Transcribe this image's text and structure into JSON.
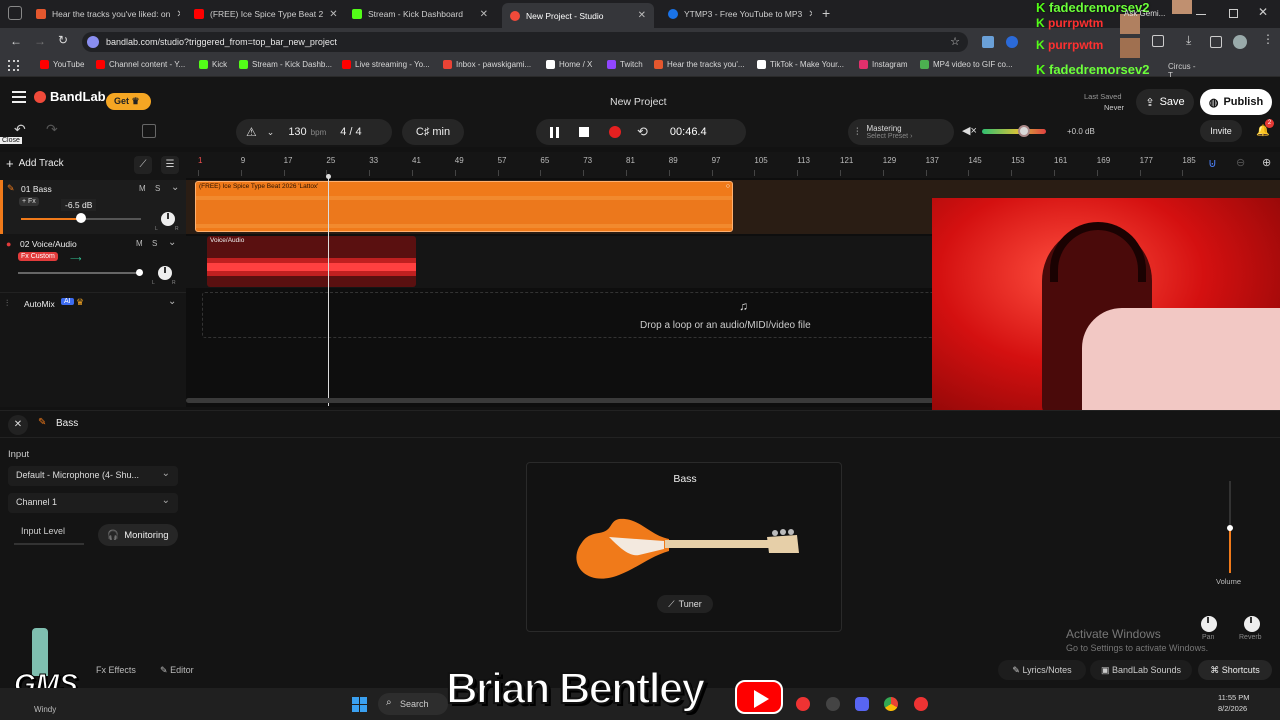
{
  "browser": {
    "tabs": [
      {
        "label": "Hear the tracks you've liked: on",
        "color": "#e4572e"
      },
      {
        "label": "(FREE) Ice Spice Type Beat 2",
        "color": "#ff0000"
      },
      {
        "label": "Stream - Kick Dashboard",
        "color": "#53fc18"
      },
      {
        "label": "New Project - Studio",
        "color": "#f04a3a"
      },
      {
        "label": "YTMP3 - Free YouTube to MP3",
        "color": "#1a73e8"
      }
    ],
    "url": "bandlab.com/studio?triggered_from=top_bar_new_project",
    "bookmarks": [
      {
        "label": "YouTube",
        "color": "#ff0000"
      },
      {
        "label": "Channel content - Y...",
        "color": "#ff0000"
      },
      {
        "label": "Kick",
        "color": "#53fc18"
      },
      {
        "label": "Stream - Kick Dashb...",
        "color": "#53fc18"
      },
      {
        "label": "Live streaming - Yo...",
        "color": "#ff0000"
      },
      {
        "label": "Inbox - pawskigami...",
        "color": "#ea4335"
      },
      {
        "label": "Home / X",
        "color": "#ffffff"
      },
      {
        "label": "Twitch",
        "color": "#9146ff"
      },
      {
        "label": "Hear the tracks you'...",
        "color": "#e4572e"
      },
      {
        "label": "TikTok - Make Your...",
        "color": "#ffffff"
      },
      {
        "label": "Instagram",
        "color": "#e1306c"
      },
      {
        "label": "MP4 video to GIF co...",
        "color": "#4caf50"
      }
    ]
  },
  "overlay": {
    "chat_names": [
      "fadedremorsev2",
      "purrpwtm",
      "purrpwtm",
      "fadedremorsev2"
    ],
    "ask_gemini": "Ask Gemi...",
    "cast_text": "Circus - T..."
  },
  "app": {
    "brand": "BandLab",
    "get_label": "Get",
    "project_title": "New Project",
    "last_saved_label": "Last Saved",
    "last_saved_value": "Never",
    "save_label": "Save",
    "publish_label": "Publish",
    "close_tooltip": "Close",
    "invite_label": "Invite",
    "notification_count": "2"
  },
  "transport": {
    "tempo": "130",
    "tempo_unit": "bpm",
    "time_sig_num": "4",
    "time_sig_den": "4",
    "key": "C♯ min",
    "time": "00:46.4",
    "mastering_label": "Mastering",
    "mastering_preset": "Select Preset",
    "master_volume_db": "+0.0 dB"
  },
  "ruler": {
    "ticks": [
      "1",
      "9",
      "17",
      "25",
      "33",
      "41",
      "49",
      "57",
      "65",
      "73",
      "81",
      "89",
      "97",
      "105",
      "113",
      "121",
      "129",
      "137",
      "145",
      "153",
      "161",
      "169",
      "177",
      "185"
    ]
  },
  "tracks": {
    "add_track_label": "Add Track",
    "items": [
      {
        "name": "01  Bass",
        "fx": "+ Fx",
        "volume": "-6.5 dB",
        "color": "#f07a1a"
      },
      {
        "name": "02  Voice/Audio",
        "fx": "Fx Custom",
        "color": "#e23b3b"
      }
    ],
    "automix_label": "AutoMix",
    "automix_badge": "AI",
    "mute_label": "M",
    "solo_label": "S",
    "pan_l": "L",
    "pan_r": "R"
  },
  "clips": {
    "bass_clip_title": "(FREE) Ice Spice Type Beat 2026 'Lattox'",
    "voice_clip_title": "Voice/Audio",
    "drop_text": "Drop a loop or an audio/MIDI/video file"
  },
  "panel": {
    "track_name": "Bass",
    "input_label": "Input",
    "input_device": "Default - Microphone (4- Shu...",
    "channel": "Channel 1",
    "input_level_label": "Input Level",
    "monitoring_label": "Monitoring",
    "instrument_title": "Bass",
    "tuner_label": "Tuner",
    "volume_label": "Volume",
    "pan_label": "Pan",
    "reverb_label": "Reverb",
    "effects_label": "Effects",
    "editor_label": "Editor",
    "lyrics_label": "Lyrics/Notes",
    "sounds_label": "BandLab Sounds",
    "shortcuts_label": "Shortcuts",
    "activate_title": "Activate Windows",
    "activate_sub": "Go to Settings to activate Windows."
  },
  "stream_overlay": {
    "brand_text": "Brian Bentley",
    "logo_text": "GMS",
    "weather_text": "Windy"
  },
  "taskbar": {
    "search_placeholder": "Search",
    "clock_time": "11:55 PM",
    "clock_date": "8/2/2026"
  }
}
